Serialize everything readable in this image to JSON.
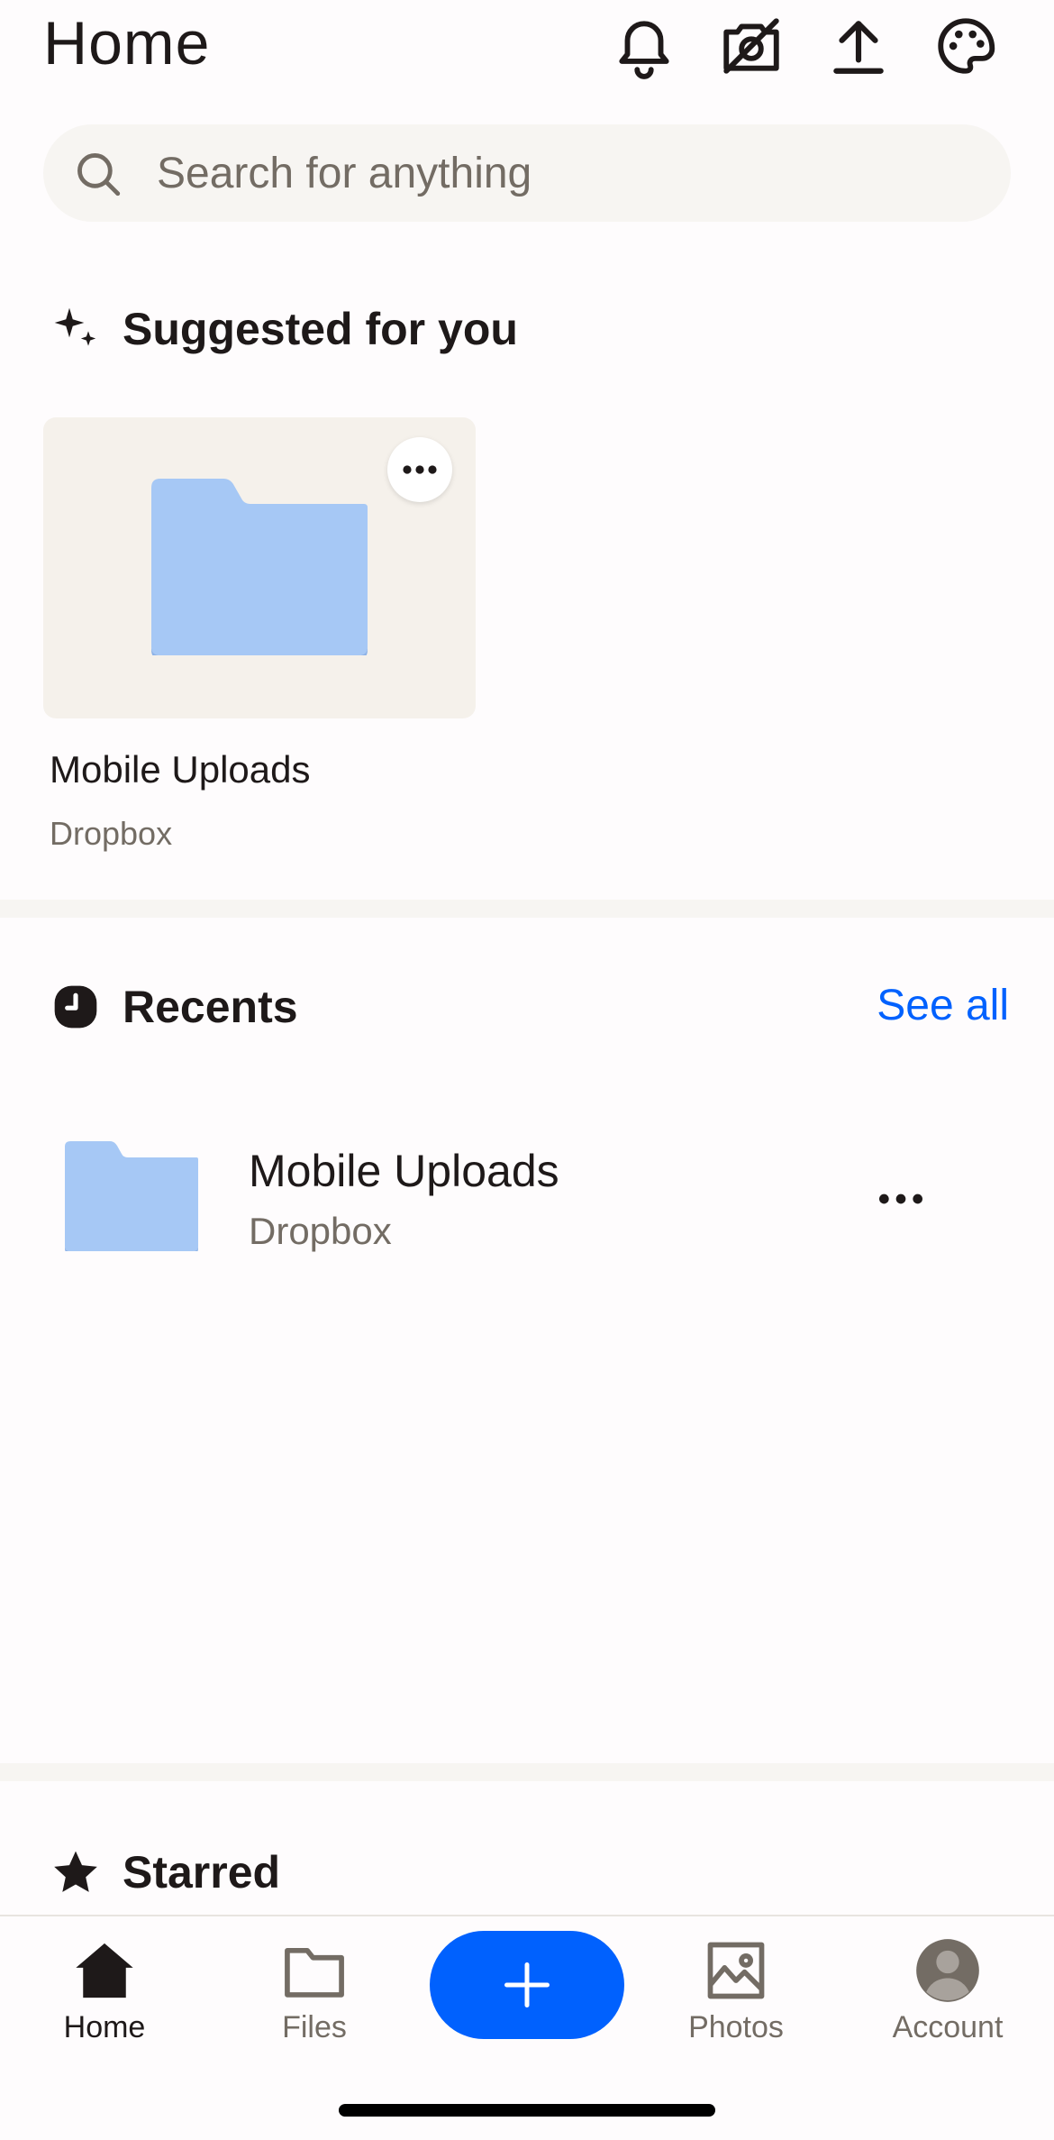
{
  "header": {
    "title": "Home",
    "icons": [
      "bell-icon",
      "camera-off-icon",
      "upload-icon",
      "palette-icon"
    ]
  },
  "search": {
    "placeholder": "Search for anything",
    "value": ""
  },
  "suggested": {
    "title": "Suggested for you",
    "items": [
      {
        "name": "Mobile Uploads",
        "location": "Dropbox"
      }
    ]
  },
  "recents": {
    "title": "Recents",
    "see_all": "See all",
    "items": [
      {
        "name": "Mobile Uploads",
        "location": "Dropbox"
      }
    ]
  },
  "starred": {
    "title": "Starred"
  },
  "bottom_nav": {
    "items": [
      {
        "label": "Home",
        "active": true
      },
      {
        "label": "Files"
      },
      {
        "label": "Photos"
      },
      {
        "label": "Account"
      }
    ]
  },
  "colors": {
    "accent": "#0061fe",
    "folder": "#a6c8f5",
    "folder_dark": "#8db3e8",
    "muted": "#736c64"
  }
}
